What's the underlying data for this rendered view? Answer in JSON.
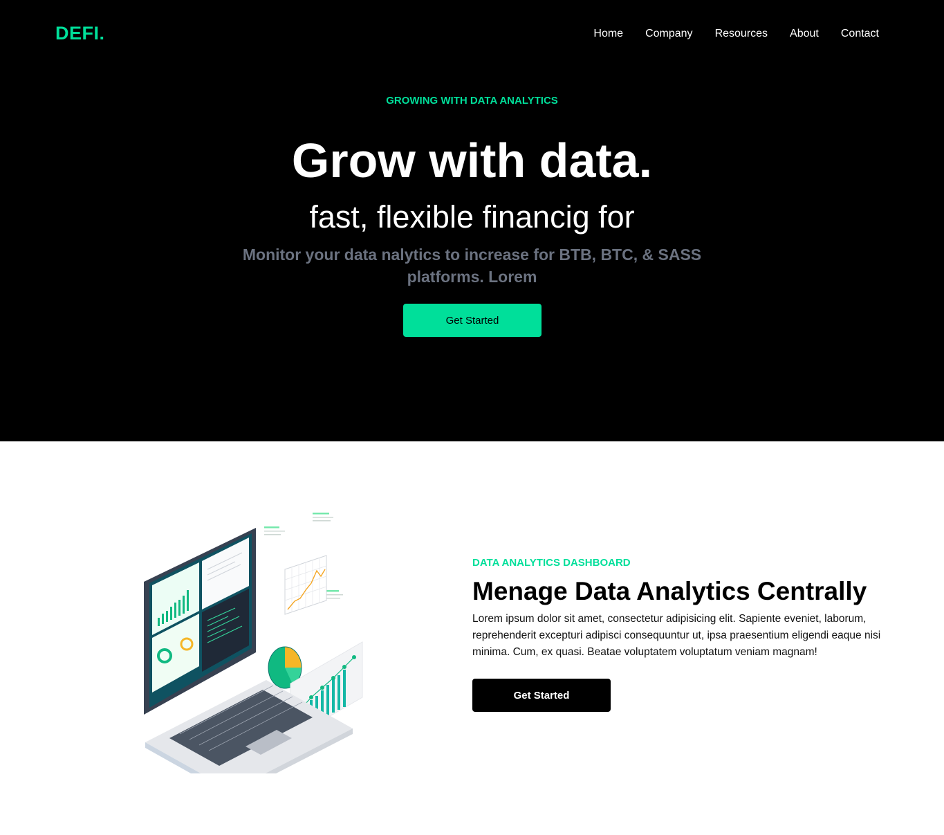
{
  "header": {
    "logo": "DEFI.",
    "nav": [
      "Home",
      "Company",
      "Resources",
      "About",
      "Contact"
    ]
  },
  "hero": {
    "eyebrow": "GROWING WITH DATA ANALYTICS",
    "title": "Grow with data.",
    "subtitle": "fast, flexible financig for",
    "description": "Monitor your data nalytics to increase for BTB, BTC, & SASS platforms. Lorem",
    "cta_label": "Get Started"
  },
  "analytics": {
    "eyebrow": "DATA ANALYTICS DASHBOARD",
    "title": "Menage Data Analytics Centrally",
    "body": "Lorem ipsum dolor sit amet, consectetur adipisicing elit. Sapiente eveniet, laborum, reprehenderit excepturi adipisci consequuntur ut, ipsa praesentium eligendi eaque nisi minima. Cum, ex quasi. Beatae voluptatem voluptatum veniam magnam!",
    "cta_label": "Get Started"
  },
  "colors": {
    "accent": "#00df9a",
    "hero_bg": "#000000",
    "muted_text": "#6b7280"
  }
}
